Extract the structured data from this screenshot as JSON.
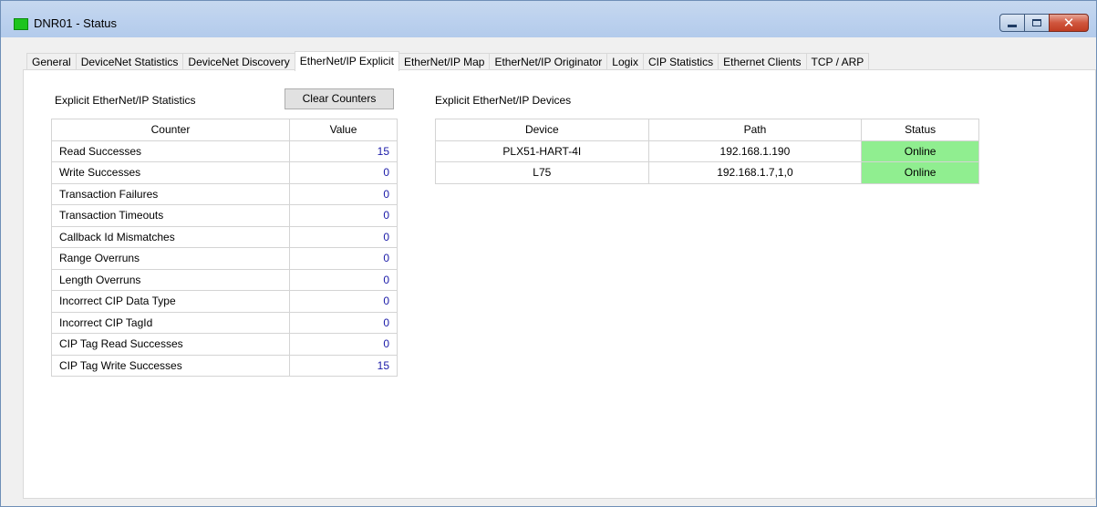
{
  "window": {
    "title": "DNR01 - Status",
    "controls": {
      "minimize": "minimize",
      "maximize": "maximize",
      "close": "close"
    }
  },
  "tabs": [
    {
      "label": "General",
      "active": false
    },
    {
      "label": "DeviceNet Statistics",
      "active": false
    },
    {
      "label": "DeviceNet Discovery",
      "active": false
    },
    {
      "label": "EtherNet/IP Explicit",
      "active": true
    },
    {
      "label": "EtherNet/IP Map",
      "active": false
    },
    {
      "label": "EtherNet/IP Originator",
      "active": false
    },
    {
      "label": "Logix",
      "active": false
    },
    {
      "label": "CIP Statistics",
      "active": false
    },
    {
      "label": "Ethernet Clients",
      "active": false
    },
    {
      "label": "TCP / ARP",
      "active": false
    }
  ],
  "stats": {
    "title": "Explicit EtherNet/IP Statistics",
    "clear_label": "Clear Counters",
    "headers": {
      "counter": "Counter",
      "value": "Value"
    },
    "rows": [
      {
        "name": "Read Successes",
        "value": "15"
      },
      {
        "name": "Write Successes",
        "value": "0"
      },
      {
        "name": "Transaction Failures",
        "value": "0"
      },
      {
        "name": "Transaction Timeouts",
        "value": "0"
      },
      {
        "name": "Callback Id Mismatches",
        "value": "0"
      },
      {
        "name": "Range Overruns",
        "value": "0"
      },
      {
        "name": "Length Overruns",
        "value": "0"
      },
      {
        "name": "Incorrect CIP Data Type",
        "value": "0"
      },
      {
        "name": "Incorrect CIP TagId",
        "value": "0"
      },
      {
        "name": "CIP Tag Read Successes",
        "value": "0"
      },
      {
        "name": "CIP Tag Write Successes",
        "value": "15"
      }
    ]
  },
  "devices": {
    "title": "Explicit EtherNet/IP Devices",
    "headers": {
      "device": "Device",
      "path": "Path",
      "status": "Status"
    },
    "rows": [
      {
        "device": "PLX51-HART-4I",
        "path": "192.168.1.190",
        "status": "Online"
      },
      {
        "device": "L75",
        "path": "192.168.1.7,1,0",
        "status": "Online"
      }
    ]
  },
  "colors": {
    "online": "#90ee90",
    "value_text": "#1a1aa8",
    "status_icon": "#1ec41e"
  }
}
